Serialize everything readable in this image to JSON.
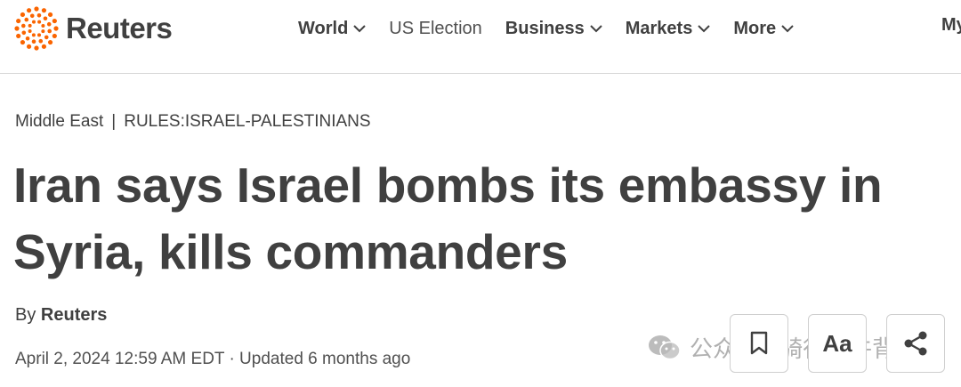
{
  "brand": {
    "name": "Reuters",
    "accent_color": "#fa6400"
  },
  "nav": {
    "items": [
      {
        "label": "World",
        "dropdown": true
      },
      {
        "label": "US Election",
        "dropdown": false
      },
      {
        "label": "Business",
        "dropdown": true
      },
      {
        "label": "Markets",
        "dropdown": true
      },
      {
        "label": "More",
        "dropdown": true
      }
    ],
    "cutoff_label": "My"
  },
  "article": {
    "breadcrumb": {
      "section": "Middle East",
      "separator": "|",
      "tag": "RULES:ISRAEL-PALESTINIANS"
    },
    "headline": "Iran says Israel bombs its embassy in Syria, kills commanders",
    "byline": {
      "prefix": "By",
      "author": "Reuters"
    },
    "dateline": "April 2, 2024 12:59 AM EDT · Updated 6 months ago"
  },
  "actions": {
    "save_icon": "bookmark-icon",
    "text_size_label": "Aa",
    "share_icon": "share-icon"
  },
  "watermark": {
    "text": "公众号 · 骑行牦牛背"
  }
}
